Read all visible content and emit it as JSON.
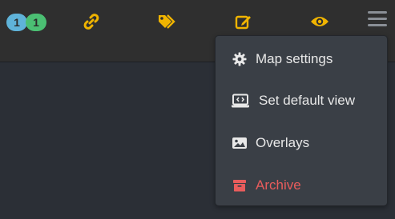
{
  "toolbar": {
    "counters": [
      {
        "value": "1",
        "color": "#5fb3d9"
      },
      {
        "value": "1",
        "color": "#4bbf73"
      }
    ],
    "tools": [
      {
        "icon": "link-icon",
        "color": "#f0b400"
      },
      {
        "icon": "tags-icon",
        "color": "#f0b400"
      },
      {
        "icon": "edit-icon",
        "color": "#f0b400"
      },
      {
        "icon": "eye-icon",
        "color": "#f0b400"
      }
    ],
    "menu_icon": "hamburger-menu-icon"
  },
  "menu": {
    "items": [
      {
        "label": "Map settings",
        "icon": "gear-icon"
      },
      {
        "label": "Set default view",
        "icon": "laptop-code-icon"
      },
      {
        "label": "Overlays",
        "icon": "image-icon"
      },
      {
        "label": "Archive",
        "icon": "archive-box-icon",
        "color": "#e85c5c"
      }
    ]
  }
}
